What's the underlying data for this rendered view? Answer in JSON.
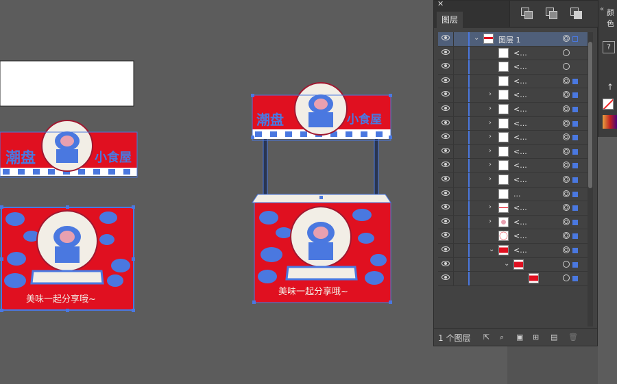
{
  "panel": {
    "tab": "图层",
    "footer_count": "1 个图层",
    "layer_name": "图层 1",
    "row_label": "<...",
    "row_label_dots": "...",
    "rows": [
      {
        "type": "layer",
        "label": "图层 1",
        "twisty": "v",
        "thumb": "art",
        "target": "double",
        "sq": true
      },
      {
        "type": "item",
        "label": "<...",
        "twisty": "",
        "thumb": "white",
        "target": "single",
        "sq": false
      },
      {
        "type": "item",
        "label": "<...",
        "twisty": "",
        "thumb": "white",
        "target": "single",
        "sq": false
      },
      {
        "type": "item",
        "label": "<...",
        "twisty": "",
        "thumb": "white",
        "target": "double",
        "sq": true
      },
      {
        "type": "item",
        "label": "<...",
        "twisty": ">",
        "thumb": "white",
        "target": "double",
        "sq": true
      },
      {
        "type": "item",
        "label": "<...",
        "twisty": ">",
        "thumb": "white",
        "target": "double",
        "sq": true
      },
      {
        "type": "item",
        "label": "<...",
        "twisty": ">",
        "thumb": "white",
        "target": "double",
        "sq": true
      },
      {
        "type": "item",
        "label": "<...",
        "twisty": ">",
        "thumb": "white",
        "target": "double",
        "sq": true
      },
      {
        "type": "item",
        "label": "<...",
        "twisty": ">",
        "thumb": "white",
        "target": "double",
        "sq": true
      },
      {
        "type": "item",
        "label": "<...",
        "twisty": ">",
        "thumb": "white",
        "target": "double",
        "sq": true
      },
      {
        "type": "item",
        "label": "<...",
        "twisty": ">",
        "thumb": "white",
        "target": "double",
        "sq": true
      },
      {
        "type": "item",
        "label": "...",
        "twisty": "",
        "thumb": "white",
        "target": "double",
        "sq": true
      },
      {
        "type": "item",
        "label": "<...",
        "twisty": ">",
        "thumb": "banner",
        "target": "double",
        "sq": true
      },
      {
        "type": "item",
        "label": "<...",
        "twisty": ">",
        "thumb": "figure",
        "target": "double",
        "sq": true
      },
      {
        "type": "item",
        "label": "<...",
        "twisty": "",
        "thumb": "circle",
        "target": "double",
        "sq": true
      },
      {
        "type": "item",
        "label": "<...",
        "twisty": "v",
        "thumb": "red",
        "target": "double",
        "sq": true
      },
      {
        "type": "item",
        "label": "",
        "twisty": "v",
        "thumb": "red2",
        "target": "single",
        "sq": true
      },
      {
        "type": "item",
        "label": "",
        "twisty": "",
        "thumb": "red3",
        "target": "single",
        "sq": true
      }
    ]
  },
  "mini_panel": {
    "label": "颜色",
    "help": "?"
  },
  "artwork": {
    "slogan": "美味一起分享哦~",
    "sign_left": "潮盘",
    "sign_right": "小食屋"
  },
  "colors": {
    "red": "#e01020",
    "blue": "#4a78e0",
    "cream": "#f2eee6",
    "pink": "#e8a0b0",
    "selection": "#4a78e0"
  }
}
